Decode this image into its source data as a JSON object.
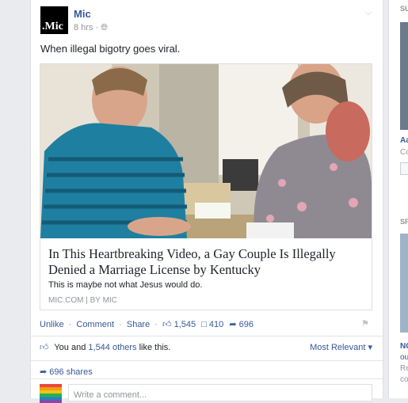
{
  "post": {
    "author": "Mic",
    "avatar_text": ".Mic",
    "time": "8 hrs",
    "privacy_icon": "globe-icon",
    "status": "When illegal bigotry goes viral.",
    "link": {
      "title": "In This Heartbreaking Video, a Gay Couple Is Illegally Denied a Marriage License by Kentucky",
      "description": "This is maybe not what Jesus would do.",
      "domain": "MIC.COM",
      "byline": "BY MIC"
    },
    "actions": {
      "unlike": "Unlike",
      "comment": "Comment",
      "share": "Share",
      "like_count": "1,545",
      "comment_count": "410",
      "share_count": "696"
    },
    "likes_summary": {
      "prefix": "You and ",
      "others": "1,544 others",
      "suffix": " like this."
    },
    "sort_label": "Most Relevant",
    "shares_label": "696 shares",
    "comment_placeholder": "Write a comment..."
  },
  "right_column": {
    "label_1": "SU",
    "text_1": "Aa",
    "text_2": "Co",
    "label_2": "SF",
    "text_3": "NC",
    "text_4": "ou",
    "text_5": "Re",
    "text_6": "co"
  },
  "colors": {
    "link": "#365899",
    "like_blue": "#4267b2",
    "background": "#e9ebee"
  }
}
